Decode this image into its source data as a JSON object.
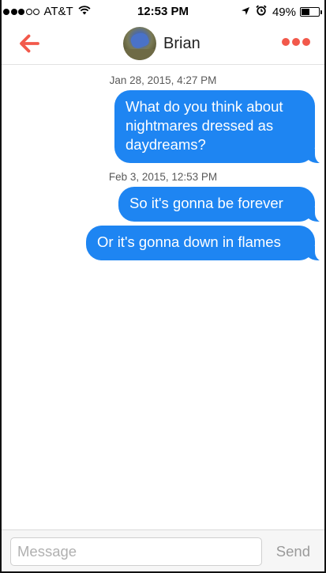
{
  "status_bar": {
    "carrier": "AT&T",
    "signal_bars_filled": 3,
    "signal_bars_total": 5,
    "time": "12:53 PM",
    "battery_percent": "49%",
    "battery_level": 0.49,
    "icons": [
      "wifi-icon",
      "location-arrow-icon",
      "alarm-clock-icon",
      "battery-icon"
    ]
  },
  "nav": {
    "back_icon": "back-arrow-icon",
    "contact_name": "Brian",
    "more_icon": "more-dots-icon",
    "accent_color": "#f2594b"
  },
  "conversation": [
    {
      "timestamp": "Jan 28, 2015, 4:27 PM"
    },
    {
      "message": "What do you think about nightmares dressed as daydreams?"
    },
    {
      "timestamp": "Feb 3, 2015, 12:53 PM"
    },
    {
      "message": "So it's gonna be forever"
    },
    {
      "message": "Or it's gonna down in flames"
    }
  ],
  "bubble_color": "#1e85f2",
  "composer": {
    "placeholder": "Message",
    "value": "",
    "send_label": "Send"
  }
}
